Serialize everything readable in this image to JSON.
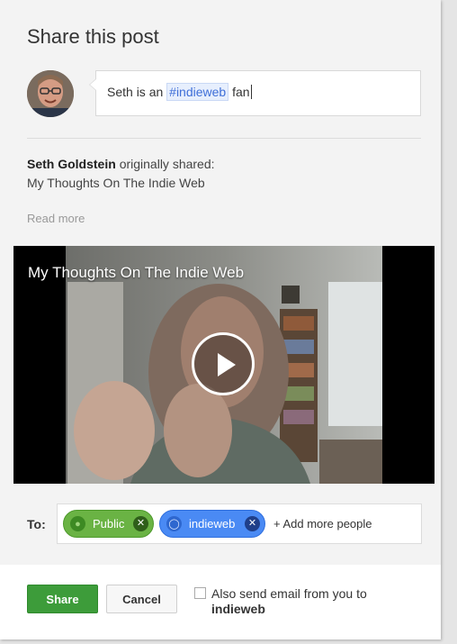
{
  "dialog": {
    "title": "Share this post"
  },
  "comment": {
    "prefix": "Seth is an",
    "hashtag": "#indieweb",
    "suffix": "fan"
  },
  "shared": {
    "author": "Seth Goldstein",
    "action": "originally shared:",
    "post_title": "My Thoughts On The Indie Web",
    "read_more": "Read more"
  },
  "video": {
    "title": "My Thoughts On The Indie Web",
    "play_icon": "play-icon"
  },
  "audience": {
    "label": "To:",
    "chips": [
      {
        "label": "Public",
        "icon": "globe-icon",
        "color": "#6ab344"
      },
      {
        "label": "indieweb",
        "icon": "circles-icon",
        "color": "#4a8af4"
      }
    ],
    "add_more": "+ Add more people"
  },
  "footer": {
    "share_label": "Share",
    "cancel_label": "Cancel",
    "email_label_1": "Also send email from you to",
    "email_label_2": "indieweb"
  },
  "colors": {
    "accent_green": "#3d9c3a",
    "hashtag_blue": "#3f6fd8"
  }
}
